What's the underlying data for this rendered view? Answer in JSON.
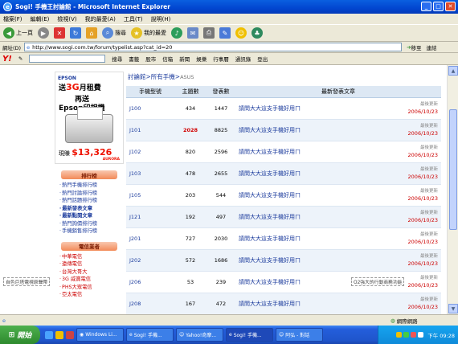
{
  "window": {
    "title": "Sogi! 手機王討論館 - Microsoft Internet Explorer"
  },
  "menu": [
    "檔案(F)",
    "編輯(E)",
    "檢視(V)",
    "我的最愛(A)",
    "工具(T)",
    "說明(H)"
  ],
  "toolbar": {
    "back": "上一頁",
    "search": "搜尋",
    "favorites": "我的最愛"
  },
  "address": {
    "label": "網址(D)",
    "url": "http://www.sogi.com.tw/forum/typelist.asp?cat_id=20",
    "go": "移至",
    "links": "連結"
  },
  "yahoo": {
    "logo": "Y!",
    "search_btn": "搜尋",
    "items": [
      "書籤",
      "股市",
      "信箱",
      "新聞",
      "娛樂",
      "行事曆",
      "通訊錄",
      "登出"
    ]
  },
  "ad": {
    "brand": "EPSON",
    "line1_pre": "送",
    "line1_big": "3G",
    "line1_post": "月租費",
    "line2": "再送",
    "line3": "Epson印相機",
    "price_label": "現賺",
    "price": "$13,326",
    "brand2": "AURORA"
  },
  "sidebar": {
    "rank_title": "排行榜",
    "rank_items": [
      "熱門手機排行榜",
      "熱門討論排行榜",
      "熱門話題排行榜",
      "最新發表文章",
      "最新點閱文章",
      "熱門詢價排行榜",
      "手機銷售排行榜"
    ],
    "carrier_title": "電信業者",
    "carrier_items": [
      "中華電信",
      "遠傳電信",
      "台灣大哥大",
      "3G 威寶電信",
      "PHS大眾電信",
      "亞太電信"
    ]
  },
  "breadcrumb": {
    "root": "討論館",
    "sep": ">",
    "cat": "所有手機",
    "cur": "ASUS"
  },
  "table": {
    "headers": [
      "手機型號",
      "主題數",
      "發表數",
      "最新發表文章"
    ],
    "update_label": "最後更新",
    "rows": [
      {
        "model": "J100",
        "topics": "434",
        "posts": "1447",
        "latest": "請問大大這支手機好用ㄇ",
        "date": "2006/10/23"
      },
      {
        "model": "J101",
        "topics": "2028",
        "posts": "8825",
        "latest": "請問大大這支手機好用ㄇ",
        "date": "2006/10/23",
        "hot": true
      },
      {
        "model": "J102",
        "topics": "820",
        "posts": "2596",
        "latest": "請問大大這支手機好用ㄇ",
        "date": "2006/10/23"
      },
      {
        "model": "J103",
        "topics": "478",
        "posts": "2655",
        "latest": "請問大大這支手機好用ㄇ",
        "date": "2006/10/23"
      },
      {
        "model": "J105",
        "topics": "203",
        "posts": "544",
        "latest": "請問大大這支手機好用ㄇ",
        "date": "2006/10/23"
      },
      {
        "model": "J121",
        "topics": "192",
        "posts": "497",
        "latest": "請問大大這支手機好用ㄇ",
        "date": "2006/10/23"
      },
      {
        "model": "J201",
        "topics": "727",
        "posts": "2030",
        "latest": "請問大大這支手機好用ㄇ",
        "date": "2006/10/23"
      },
      {
        "model": "J202",
        "topics": "572",
        "posts": "1686",
        "latest": "請問大大這支手機好用ㄇ",
        "date": "2006/10/23"
      },
      {
        "model": "J206",
        "topics": "53",
        "posts": "239",
        "latest": "請問大大這支手機好用ㄇ",
        "date": "2006/10/23"
      },
      {
        "model": "J208",
        "topics": "167",
        "posts": "472",
        "latest": "請問大大這支手機好用ㄇ",
        "date": "2006/10/23"
      }
    ]
  },
  "marquee": {
    "left": "自色巨塔電視原聲帶",
    "right": "O2強大的行動商務功能"
  },
  "status": {
    "zone": "網際網路"
  },
  "taskbar": {
    "start": "開始",
    "tasks": [
      "Windows Li...",
      "Sogi! 手機...",
      "Yahoo!奇摩...",
      "Sogi! 手機...",
      "阿弘 - 對話"
    ],
    "clock": "下午 09:28"
  },
  "colors": {
    "link": "#1a3a9c",
    "hot": "#d10000",
    "title_bar": "#0246d0"
  }
}
